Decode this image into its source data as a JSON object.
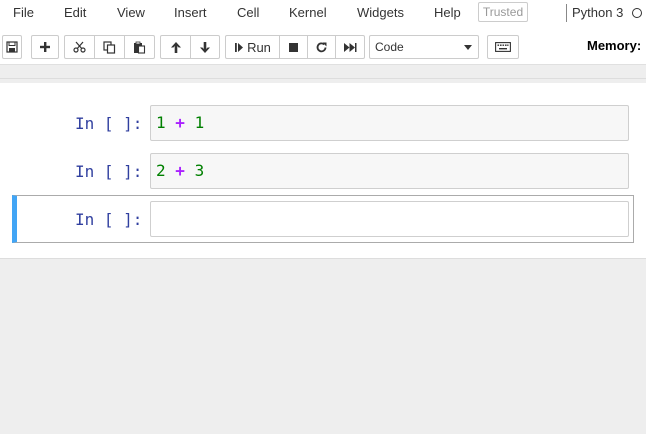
{
  "menubar": {
    "items": [
      "File",
      "Edit",
      "View",
      "Insert",
      "Cell",
      "Kernel",
      "Widgets",
      "Help"
    ],
    "trusted": "Trusted",
    "kernel_name": "Python 3"
  },
  "toolbar": {
    "buttons": [
      "save-icon",
      "plus-icon",
      "cut-icon",
      "copy-icon",
      "paste-icon",
      "arrow-up-icon",
      "arrow-down-icon",
      "run-icon",
      "stop-icon",
      "restart-icon",
      "fast-forward-icon",
      "keyboard-icon"
    ],
    "run_label": "Run",
    "cell_type": "Code",
    "memory_label": "Memory:"
  },
  "cells": [
    {
      "prompt": "In [ ]:",
      "tokens": [
        "1",
        "+",
        "1"
      ]
    },
    {
      "prompt": "In [ ]:",
      "tokens": [
        "2",
        "+",
        "3"
      ]
    },
    {
      "prompt": "In [ ]:",
      "tokens": []
    }
  ],
  "colors": {
    "prompt": "#303f9f",
    "number": "#008000",
    "operator": "#aa22ff",
    "selected_cell_bar": "#42a5f5"
  }
}
